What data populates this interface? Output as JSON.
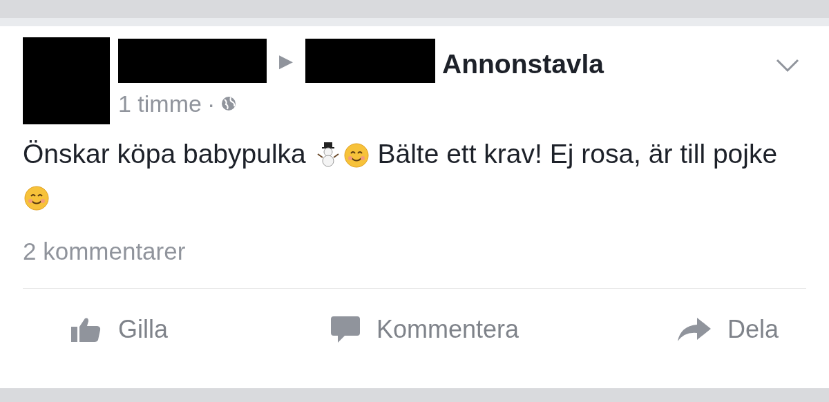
{
  "post": {
    "arrow": "▶",
    "page": "Annonstavla",
    "time": "1 timme",
    "separator": "·",
    "body": [
      {
        "kind": "text",
        "text": "Önskar köpa babypulka"
      },
      {
        "kind": "snowman"
      },
      {
        "kind": "smile"
      },
      {
        "kind": "text",
        "text": "Bälte ett krav! Ej rosa, är till pojke"
      },
      {
        "kind": "smile"
      }
    ],
    "comments": "2 kommentarer",
    "actions": [
      {
        "kind": "like",
        "label": "Gilla"
      },
      {
        "kind": "comment",
        "label": "Kommentera"
      },
      {
        "kind": "share",
        "label": "Dela"
      }
    ]
  }
}
